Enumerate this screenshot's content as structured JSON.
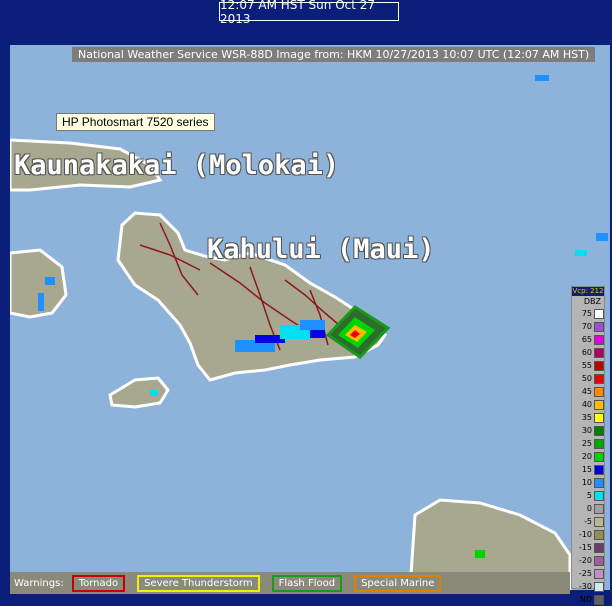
{
  "timestamp": "12:07 AM HST Sun Oct 27 2013",
  "header": "National Weather Service WSR-88D Image from: HKM 10/27/2013 10:07 UTC (12:07 AM HST)",
  "tooltip": "HP Photosmart 7520 series",
  "labels": {
    "molokai": "Kaunakakai (Molokai)",
    "maui": "Kahului (Maui)"
  },
  "legend": {
    "vcp": "Vcp: 212",
    "unit": "DBZ",
    "levels": [
      {
        "label": "75",
        "color": "#ffffff"
      },
      {
        "label": "70",
        "color": "#9c4fd0"
      },
      {
        "label": "65",
        "color": "#e000e0"
      },
      {
        "label": "60",
        "color": "#b00060"
      },
      {
        "label": "55",
        "color": "#c00000"
      },
      {
        "label": "50",
        "color": "#ee0000"
      },
      {
        "label": "45",
        "color": "#ff8800"
      },
      {
        "label": "40",
        "color": "#ffbb00"
      },
      {
        "label": "35",
        "color": "#ffff00"
      },
      {
        "label": "30",
        "color": "#007f00"
      },
      {
        "label": "25",
        "color": "#00a800"
      },
      {
        "label": "20",
        "color": "#00d400"
      },
      {
        "label": "15",
        "color": "#0000e8"
      },
      {
        "label": "10",
        "color": "#1e90ff"
      },
      {
        "label": "5",
        "color": "#00e0f0"
      },
      {
        "label": "0",
        "color": "#a0a0a0"
      },
      {
        "label": "-5",
        "color": "#b8b890"
      },
      {
        "label": "-10",
        "color": "#8f8f5a"
      },
      {
        "label": "-15",
        "color": "#6a3d6a"
      },
      {
        "label": "-20",
        "color": "#9a5e9a"
      },
      {
        "label": "-25",
        "color": "#c090c0"
      },
      {
        "label": "-30",
        "color": "#d0e8f0"
      },
      {
        "label": "ND",
        "color": "#606060"
      }
    ]
  },
  "warnings": {
    "title": "Warnings:",
    "tornado": "Tornado",
    "severe": "Severe Thunderstorm",
    "flash": "Flash Flood",
    "marine": "Special Marine"
  }
}
